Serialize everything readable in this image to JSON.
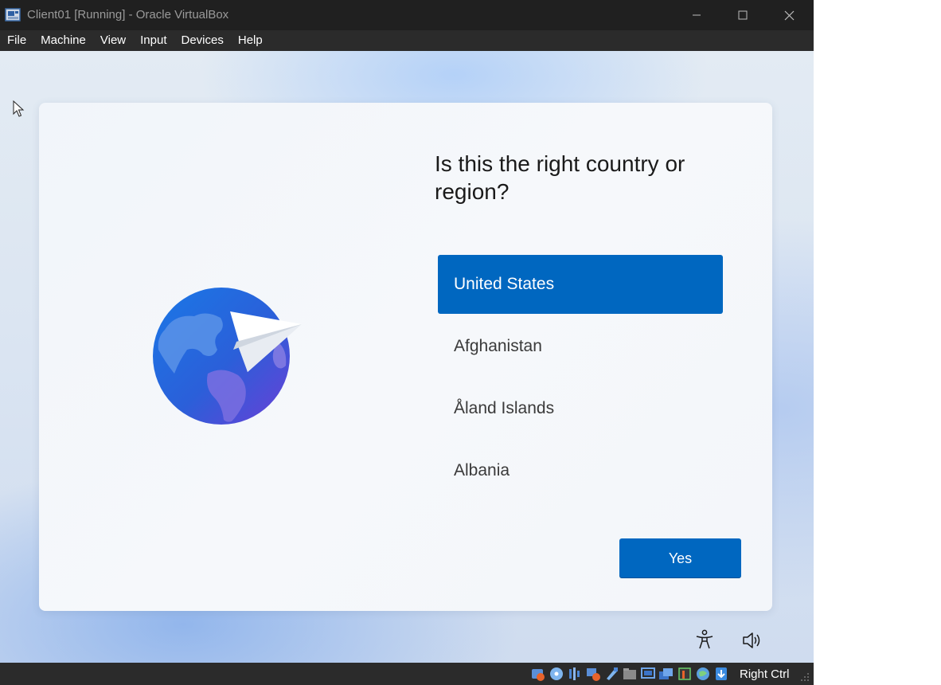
{
  "window": {
    "title": "Client01 [Running] - Oracle VirtualBox",
    "app_icon": "virtualbox-icon",
    "controls": [
      "minimize-icon",
      "maximize-icon",
      "close-icon"
    ]
  },
  "menubar": {
    "items": [
      {
        "label": "File"
      },
      {
        "label": "Machine"
      },
      {
        "label": "View"
      },
      {
        "label": "Input"
      },
      {
        "label": "Devices"
      },
      {
        "label": "Help"
      }
    ]
  },
  "oobe": {
    "heading": "Is this the right country or region?",
    "countries": [
      {
        "label": "United States",
        "selected": true
      },
      {
        "label": "Afghanistan",
        "selected": false
      },
      {
        "label": "Åland Islands",
        "selected": false
      },
      {
        "label": "Albania",
        "selected": false
      }
    ],
    "confirm_label": "Yes",
    "illustration": "globe-paper-plane-icon",
    "accent_color": "#0067c0",
    "bottom_icons": [
      "accessibility-icon",
      "volume-icon"
    ]
  },
  "statusbar": {
    "icons": [
      "hard-disk-icon",
      "optical-drive-icon",
      "audio-icon",
      "network-icon",
      "usb-icon",
      "shared-folders-icon",
      "display-icon",
      "recording-icon",
      "cpu-icon",
      "guest-additions-icon",
      "mouse-integration-icon"
    ],
    "host_key": "Right Ctrl"
  }
}
